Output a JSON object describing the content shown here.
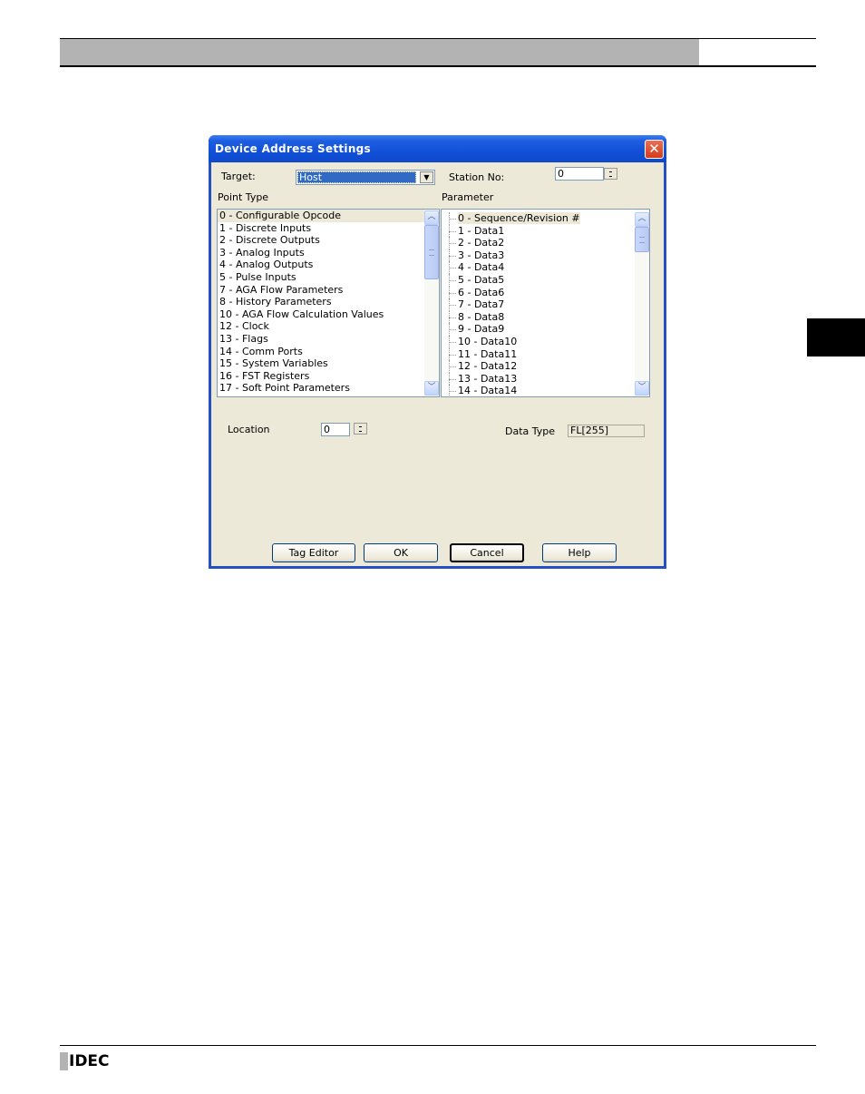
{
  "page": {
    "footer_logo": "IDEC"
  },
  "dialog": {
    "title": "Device Address Settings",
    "close_icon": "close-icon",
    "target_label": "Target:",
    "target_value": "Host",
    "station_label": "Station No:",
    "station_value": "0",
    "point_type_label": "Point Type",
    "parameter_label": "Parameter",
    "point_types": [
      "0 - Configurable Opcode",
      "1 - Discrete Inputs",
      "2 - Discrete Outputs",
      "3 - Analog Inputs",
      "4 - Analog Outputs",
      "5 - Pulse Inputs",
      "7 - AGA Flow Parameters",
      "8 - History Parameters",
      "10 - AGA Flow Calculation Values",
      "12 - Clock",
      "13 - Flags",
      "14 - Comm Ports",
      "15 - System Variables",
      "16 - FST Registers",
      "17 - Soft Point Parameters"
    ],
    "parameters": [
      "0 - Sequence/Revision #",
      "1 - Data1",
      "2 - Data2",
      "3 - Data3",
      "4 - Data4",
      "5 - Data5",
      "6 - Data6",
      "7 - Data7",
      "8 - Data8",
      "9 - Data9",
      "10 - Data10",
      "11 - Data11",
      "12 - Data12",
      "13 - Data13",
      "14 - Data14"
    ],
    "location_label": "Location",
    "location_value": "0",
    "data_type_label": "Data Type",
    "data_type_value": "FL[255]",
    "buttons": {
      "tag_editor": "Tag Editor",
      "ok": "OK",
      "cancel": "Cancel",
      "help": "Help"
    }
  }
}
